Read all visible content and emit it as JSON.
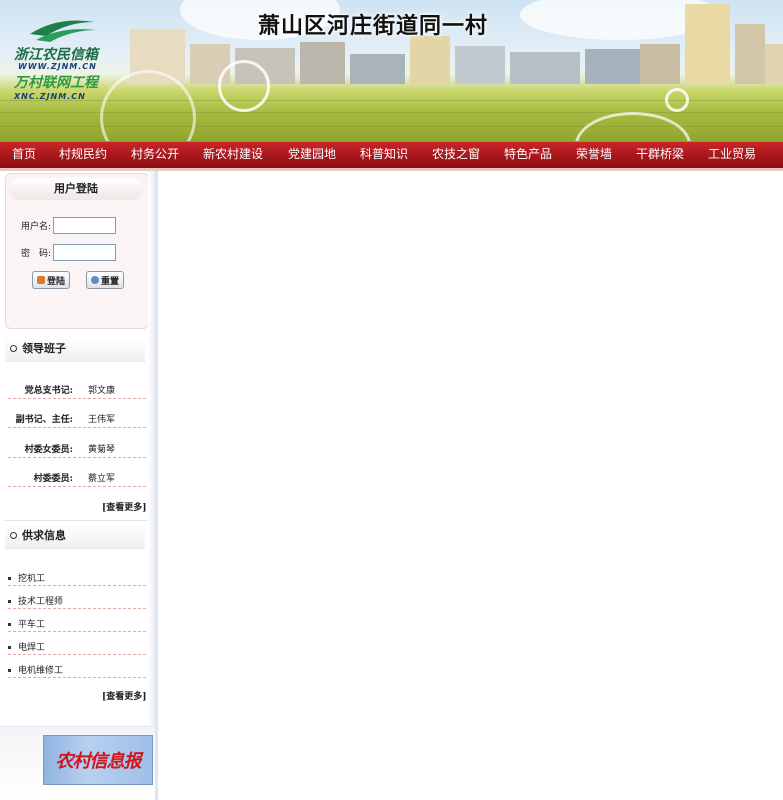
{
  "banner": {
    "village_title": "萧山区河庄街道同一村",
    "logo_line1": "浙江农民信箱",
    "logo_url1": "WWW.ZJNM.CN",
    "logo_line2": "万村联网工程",
    "logo_url2": "XNC.ZJNM.CN"
  },
  "nav": {
    "items": [
      "首页",
      "村规民约",
      "村务公开",
      "新农村建设",
      "党建园地",
      "科普知识",
      "农技之窗",
      "特色产品",
      "荣誉墙",
      "干群桥梁",
      "工业贸易"
    ]
  },
  "login": {
    "title": "用户登陆",
    "username_label": "用户名:",
    "password_label": "密　码:",
    "username_value": "",
    "password_value": "",
    "login_button": "登陆",
    "reset_button": "重置"
  },
  "leaders": {
    "title": "领导班子",
    "rows": [
      {
        "title": "党总支书记:",
        "name": "郭文康"
      },
      {
        "title": "副书记、主任:",
        "name": "王伟军"
      },
      {
        "title": "村委女委员:",
        "name": "黄菊琴"
      },
      {
        "title": "村委委员:",
        "name": "蔡立军"
      }
    ],
    "more": "[查看更多]"
  },
  "supply": {
    "title": "供求信息",
    "items": [
      "挖机工",
      "技术工程师",
      "平车工",
      "电焊工",
      "电机维修工"
    ],
    "more": "[查看更多]"
  },
  "newspaper": {
    "label": "农村信息报"
  },
  "colors": {
    "nav_red": "#a3161a",
    "nav_text": "#ffffff",
    "dash_line": "#e9a7a0"
  }
}
